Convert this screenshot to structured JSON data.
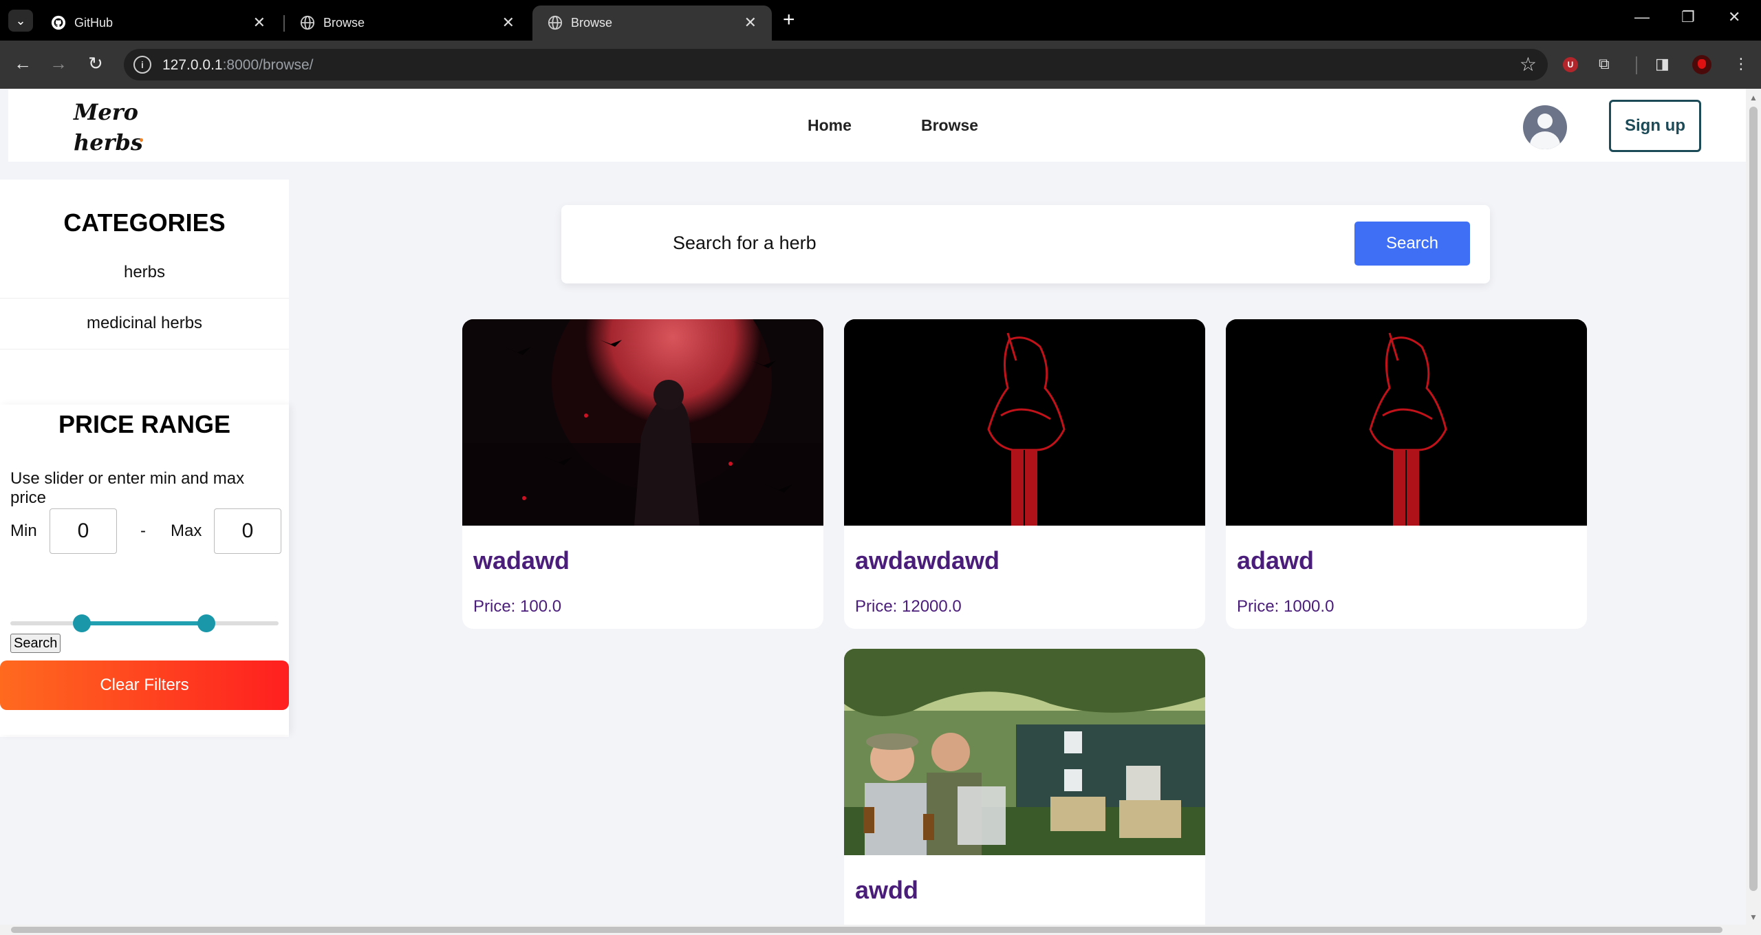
{
  "browser": {
    "tabs": [
      {
        "title": "GitHub",
        "icon": "github-icon"
      },
      {
        "title": "Browse",
        "icon": "globe-icon"
      },
      {
        "title": "Browse",
        "icon": "globe-icon"
      }
    ],
    "url_host": "127.0.0.1",
    "url_path": ":8000/browse/"
  },
  "header": {
    "logo_line1": "Mero",
    "logo_line2": "herbs",
    "nav": {
      "home": "Home",
      "browse": "Browse"
    },
    "signup_label": "Sign up"
  },
  "sidebar": {
    "categories_title": "CATEGORIES",
    "categories": [
      "herbs",
      "medicinal herbs"
    ],
    "price_title": "PRICE RANGE",
    "price_help": "Use slider or enter min and max price",
    "min_label": "Min",
    "dash": "-",
    "max_label": "Max",
    "min_value": "0",
    "max_value": "0",
    "search_label": "Search",
    "clear_label": "Clear Filters"
  },
  "search": {
    "placeholder": "Search for a herb",
    "button_label": "Search"
  },
  "products": [
    {
      "name": "wadawd",
      "price": "Price: 100.0"
    },
    {
      "name": "awdawdawd",
      "price": "Price: 12000.0"
    },
    {
      "name": "adawd",
      "price": "Price: 1000.0"
    },
    {
      "name": "awdd",
      "price": ""
    }
  ],
  "colors": {
    "accent_blue": "#3f6ff5",
    "product_title": "#4a1d7a",
    "clear_gradient_start": "#ff6a1f",
    "clear_gradient_end": "#ff1f1f",
    "slider": "#1a98aa",
    "signup_border": "#1d4a57"
  }
}
